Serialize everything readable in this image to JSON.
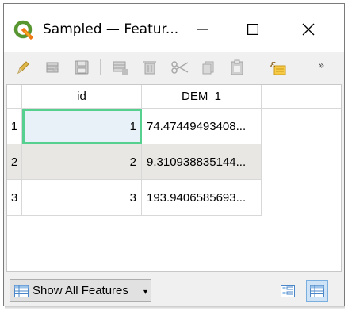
{
  "window": {
    "title": "Sampled — Featur..."
  },
  "toolbar": {
    "icons": [
      "pencil-icon",
      "multi-edit-icon",
      "save-edits-icon",
      "add-feature-icon",
      "delete-feature-icon",
      "cut-icon",
      "copy-icon",
      "paste-icon",
      "expression-select-icon"
    ],
    "more_label": "»"
  },
  "table": {
    "columns": [
      "id",
      "DEM_1"
    ],
    "rows": [
      {
        "row_num": "1",
        "id": "1",
        "DEM_1": "74.47449493408..."
      },
      {
        "row_num": "2",
        "id": "2",
        "DEM_1": "9.310938835144..."
      },
      {
        "row_num": "3",
        "id": "3",
        "DEM_1": "193.9406585693..."
      }
    ]
  },
  "bottom": {
    "filter_label": "Show All Features",
    "filter_caret": "▾"
  },
  "colors": {
    "selection_outline": "#55d08f",
    "alt_row": "#e9e7e3",
    "qgis_green": "#589632",
    "active_view": "#cfe3f7"
  }
}
